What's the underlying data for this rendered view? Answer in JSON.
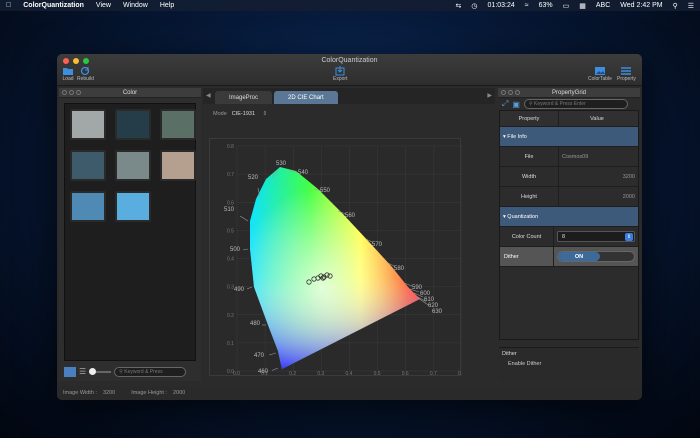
{
  "menubar": {
    "app": "ColorQuantization",
    "items": [
      "View",
      "Window",
      "Help"
    ],
    "clock": "01:03:24",
    "battery": "63%",
    "input": "ABC",
    "datetime": "Wed 2:42 PM"
  },
  "window": {
    "title": "ColorQuantization",
    "toolbar": {
      "load": "Load",
      "rebuild": "Rebuild",
      "export": "Export",
      "colortable": "ColorTable",
      "property": "Property"
    }
  },
  "color_panel": {
    "title": "Color",
    "swatches": [
      "#a2a7a8",
      "#253d48",
      "#5a6f65",
      "#3d5b6a",
      "#7a8a8b",
      "#b5a090",
      "#4f8ab5",
      "#5aaedf"
    ],
    "search_placeholder": "Keyword & Press"
  },
  "tabs": [
    "ImageProc",
    "2D CIE Chart"
  ],
  "active_tab": 1,
  "mode": {
    "label": "Mode",
    "value": "CIE-1931"
  },
  "cie_chart": {
    "wavelength_labels": [
      "460",
      "470",
      "480",
      "490",
      "500",
      "510",
      "520",
      "530",
      "540",
      "550",
      "560",
      "570",
      "580",
      "590",
      "600",
      "610",
      "620",
      "630"
    ],
    "x_ticks": [
      "0.0",
      "0.1",
      "0.2",
      "0.3",
      "0.4",
      "0.5",
      "0.6",
      "0.7",
      "0.8"
    ],
    "y_ticks": [
      "0.0",
      "0.1",
      "0.2",
      "0.3",
      "0.4",
      "0.5",
      "0.6",
      "0.7",
      "0.8"
    ]
  },
  "property_grid": {
    "title": "PropertyGrid",
    "search_placeholder": "Keyword & Press Enter",
    "col_property": "Property",
    "col_value": "Value",
    "cat_file": "File Info",
    "file_label": "File",
    "file_value": "Cosmos09",
    "width_label": "Width",
    "width_value": "3200",
    "height_label": "Height",
    "height_value": "2000",
    "cat_quant": "Quantization",
    "colorcount_label": "Color Count",
    "colorcount_value": "8",
    "dither_label": "Dither",
    "dither_value": "ON",
    "desc_title": "Dither",
    "desc_text": "Enable Dither"
  },
  "status": {
    "width_label": "Image Width :",
    "width_value": "3200",
    "height_label": "Image Height :",
    "height_value": "2000"
  }
}
